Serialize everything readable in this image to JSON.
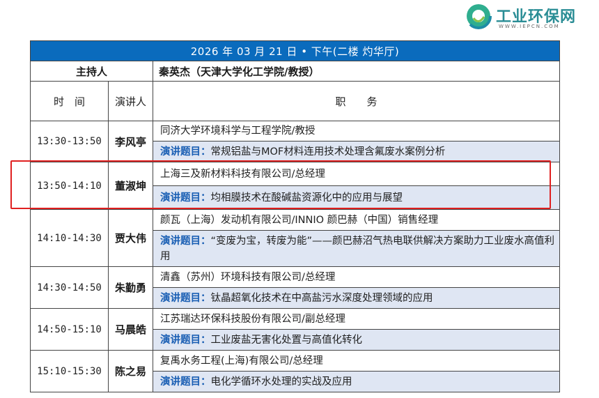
{
  "logo": {
    "name": "工业环保网",
    "url": "WWW.IEPCN.COM"
  },
  "schedule": {
    "banner": "2026 年 03 月 21 日 • 下午(二楼 灼华厅)",
    "host_label": "主持人",
    "host_name": "秦英杰（天津大学化工学院/教授）",
    "headers": {
      "time": "时　间",
      "speaker": "演讲人",
      "position": "职　　务"
    },
    "topic_label": "演讲题目：",
    "rows": [
      {
        "time": "13:30-13:50",
        "speaker": "李风亭",
        "org": "同济大学环境科学与工程学院/教授",
        "topic": "常规铝盐与MOF材料连用技术处理含氟废水案例分析"
      },
      {
        "time": "13:50-14:10",
        "speaker": "董淑坤",
        "org": "上海三及新材料科技有限公司/总经理",
        "topic": "均相膜技术在酸碱盐资源化中的应用与展望"
      },
      {
        "time": "14:10-14:30",
        "speaker": "贾大伟",
        "org": "颜瓦（上海）发动机有限公司/INNIO 颜巴赫（中国）销售经理",
        "topic": "“变废为宝，转废为能”——颜巴赫沼气热电联供解决方案助力工业废水高值利用"
      },
      {
        "time": "14:30-14:50",
        "speaker": "朱勤勇",
        "org": "清鑫（苏州）环境科技有限公司/总经理",
        "topic": "钛晶超氧化技术在中高盐污水深度处理领域的应用"
      },
      {
        "time": "14:50-15:10",
        "speaker": "马晨皓",
        "org": "江苏瑞达环保科技股份有限公司/副总经理",
        "topic": "工业废盐无害化处置与高值化转化"
      },
      {
        "time": "15:10-15:30",
        "speaker": "陈之易",
        "org": "复禹水务工程(上海)有限公司/总经理",
        "topic": "电化学循环水处理的实战及应用"
      }
    ]
  },
  "colors": {
    "banner": "#0a6bbd",
    "topic_bg": "#dfe6f3",
    "topic_label": "#1a5fb4",
    "highlight": "#e02020"
  }
}
